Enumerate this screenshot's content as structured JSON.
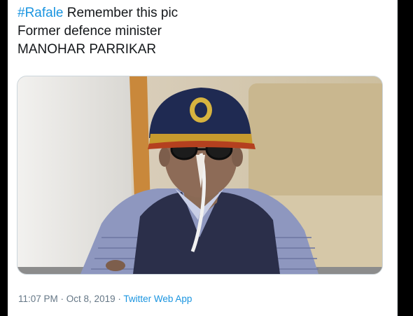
{
  "tweet": {
    "hashtag": "#Rafale",
    "line1_rest": " Remember this pic",
    "line2": "Former defence minister",
    "line3": "MANOHAR PARRIKAR"
  },
  "photo": {
    "cap_badge_icon": "emblem-badge-icon"
  },
  "meta": {
    "time": "11:07 PM",
    "sep1": " · ",
    "date": "Oct 8, 2019",
    "sep2": " · ",
    "source": "Twitter Web App"
  },
  "colors": {
    "link": "#1b95e0",
    "text": "#14171a",
    "muted": "#657786"
  }
}
